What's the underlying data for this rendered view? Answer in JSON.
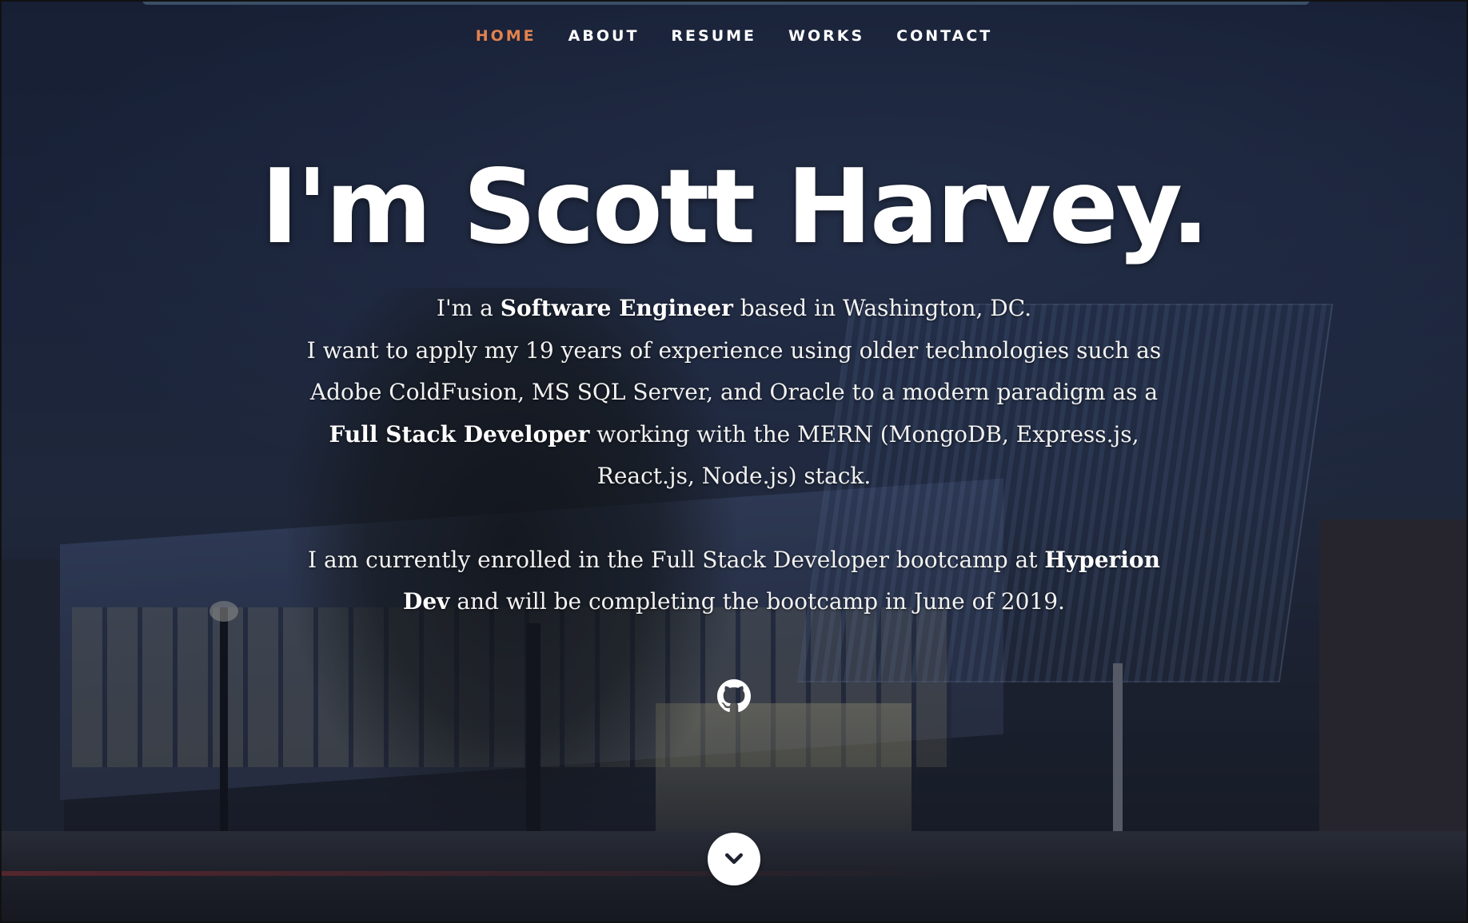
{
  "nav": {
    "items": [
      {
        "label": "HOME",
        "active": true
      },
      {
        "label": "ABOUT",
        "active": false
      },
      {
        "label": "RESUME",
        "active": false
      },
      {
        "label": "WORKS",
        "active": false
      },
      {
        "label": "CONTACT",
        "active": false
      }
    ],
    "active_color": "#e3824e"
  },
  "banner": {
    "headline": "I'm Scott Harvey.",
    "intro_p1": {
      "t1": "I'm a ",
      "b1": "Software Engineer",
      "t2": " based in Washington, DC.",
      "t3": "I want to apply my 19 years of experience using older technologies such as Adobe ColdFusion, MS SQL Server, and Oracle to a modern paradigm as a ",
      "b2": "Full Stack Developer",
      "t4": " working with the MERN (MongoDB, Express.js, React.js, Node.js) stack."
    },
    "intro_p2": {
      "t1": "I am currently enrolled in the Full Stack Developer bootcamp at ",
      "b1": "Hyperion Dev",
      "t2": " and will be completing the bootcamp in June of 2019."
    }
  },
  "social": {
    "icon": "github-icon"
  },
  "scroll": {
    "icon": "chevron-down-icon"
  }
}
